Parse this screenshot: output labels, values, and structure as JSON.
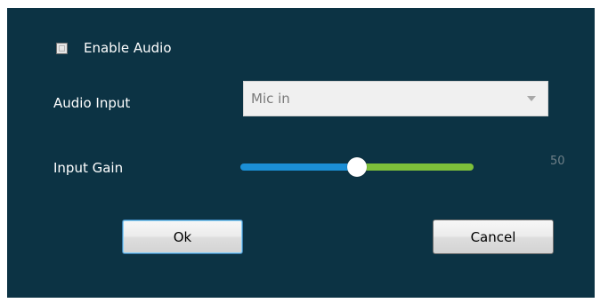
{
  "dialog": {
    "enable_audio": {
      "label": "Enable Audio",
      "checked": false
    },
    "audio_input": {
      "label": "Audio Input",
      "selected": "Mic in"
    },
    "input_gain": {
      "label": "Input Gain",
      "value": "50",
      "level_fraction": 0.5
    },
    "buttons": {
      "ok": "Ok",
      "cancel": "Cancel"
    }
  },
  "colors": {
    "dialog_background": "#0c3344",
    "slider_filled": "#1b8fd6",
    "slider_remaining": "#7dc03a",
    "gain_value_text": "#6e7f87"
  },
  "icons": {
    "combo_arrow": "chevron-down-icon"
  }
}
